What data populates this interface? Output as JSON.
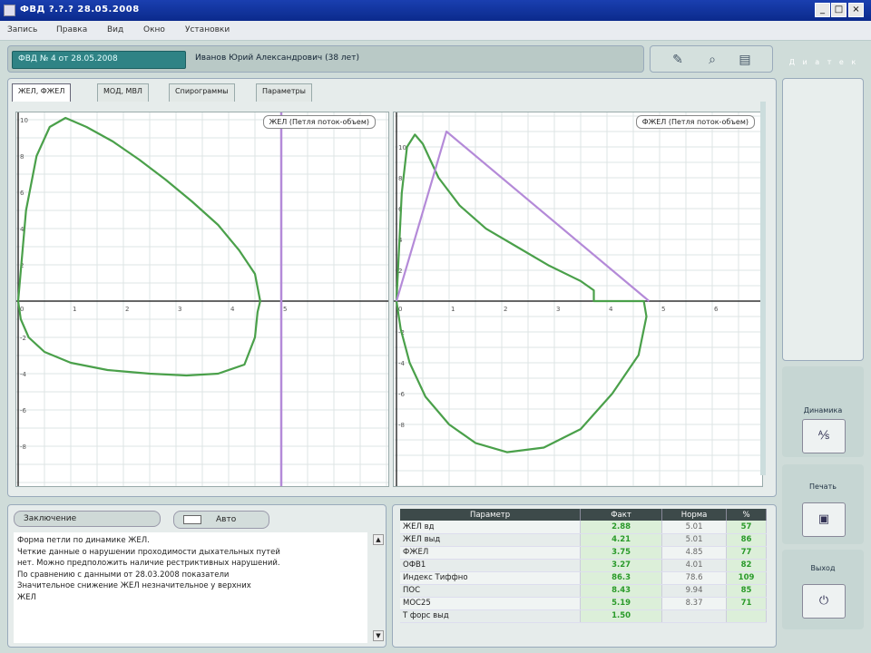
{
  "window": {
    "title": "ФВД  ?.?.?  28.05.2008"
  },
  "menu": [
    "Запись",
    "Правка",
    "Вид",
    "Окно",
    "Установки"
  ],
  "record_field": "ФВД  № 4  от  28.05.2008",
  "patient_name": "Иванов Юрий Александрович  (38 лет)",
  "toolbar": {
    "tool1_icon": "settings-icon",
    "tool2_icon": "search-icon",
    "tool3_icon": "printer-icon"
  },
  "brand_text": "Д и а т е к",
  "tabs": [
    "ЖЕЛ, ФЖЕЛ",
    "МОД, МВЛ",
    "Спирограммы",
    "Параметры"
  ],
  "chart_left": {
    "legend": "ЖЕЛ (Петля поток-объем)",
    "x_ticks": [
      "0",
      "1",
      "2",
      "3",
      "4",
      "5"
    ],
    "y_ticks": [
      "10",
      "8",
      "6",
      "4",
      "2",
      "0",
      "-2",
      "-4",
      "-6",
      "-8"
    ]
  },
  "chart_right": {
    "legend": "ФЖЕЛ (Петля поток-объем)",
    "x_ticks": [
      "0",
      "1",
      "2",
      "3",
      "4",
      "5",
      "6"
    ],
    "y_ticks": [
      "10",
      "8",
      "6",
      "4",
      "2",
      "0",
      "-2",
      "-4",
      "-6",
      "-8"
    ]
  },
  "conclusion": {
    "tab_label": "Заключение",
    "toggle_label": "Авто",
    "lines": [
      "Форма петли по динамике ЖЕЛ.",
      "Четкие данные о нарушении проходимости дыхательных путей",
      "нет. Можно предположить наличие рестриктивных нарушений.",
      "По сравнению с данными от 28.03.2008 показатели",
      "Значительное снижение ЖЕЛ незначительное у верхних",
      "ЖЕЛ"
    ]
  },
  "side": {
    "dynamics_label": "Динамика",
    "print_label": "Печать",
    "exit_label": "Выход",
    "dynamics_icon": "chart-dynamics-icon",
    "print_icon": "printer-icon",
    "exit_icon": "power-icon"
  },
  "table": {
    "headers": [
      "Параметр",
      "Факт",
      "Норма",
      "%"
    ],
    "rows": [
      {
        "param": "ЖЕЛ вд",
        "fact": "2.88",
        "norm": "5.01",
        "pct": "57"
      },
      {
        "param": "ЖЕЛ выд",
        "fact": "4.21",
        "norm": "5.01",
        "pct": "86"
      },
      {
        "param": "ФЖЕЛ",
        "fact": "3.75",
        "norm": "4.85",
        "pct": "77"
      },
      {
        "param": "ОФВ1",
        "fact": "3.27",
        "norm": "4.01",
        "pct": "82"
      },
      {
        "param": "Индекс Тиффно",
        "fact": "86.3",
        "norm": "78.6",
        "pct": "109"
      },
      {
        "param": "ПОС",
        "fact": "8.43",
        "norm": "9.94",
        "pct": "85"
      },
      {
        "param": "МОС25",
        "fact": "5.19",
        "norm": "8.37",
        "pct": "71"
      },
      {
        "param": "Т форс выд",
        "fact": "1.50",
        "norm": "",
        "pct": ""
      }
    ]
  },
  "colors": {
    "flow_curve": "#4aa04a",
    "reference": "#b48ad8",
    "accent": "#2f8385"
  },
  "chart_data": [
    {
      "type": "line",
      "title": "ЖЕЛ (Петля поток-объем)",
      "xlim": [
        0,
        7
      ],
      "ylim": [
        -10,
        10
      ],
      "series": [
        {
          "x": [
            0.0,
            0.15,
            0.35,
            0.6,
            0.9,
            1.3,
            1.8,
            2.3,
            2.8,
            3.3,
            3.8,
            4.2,
            4.5,
            4.6,
            4.55,
            4.5,
            4.3,
            3.8,
            3.2,
            2.5,
            1.7,
            1.0,
            0.5,
            0.2,
            0.05,
            0.0
          ],
          "y": [
            0,
            5,
            8,
            9.6,
            10.1,
            9.6,
            8.8,
            7.8,
            6.7,
            5.5,
            4.2,
            2.8,
            1.5,
            0,
            -0.6,
            -2.0,
            -3.5,
            -4.0,
            -4.1,
            -4.0,
            -3.8,
            -3.4,
            -2.8,
            -2.0,
            -1.0,
            0
          ]
        }
      ]
    },
    {
      "type": "line",
      "title": "ФЖЕЛ (Петля поток-объем)",
      "xlim": [
        0,
        7
      ],
      "ylim": [
        -12,
        12
      ],
      "series": [
        {
          "x": [
            0.0,
            0.1,
            0.2,
            0.35,
            0.5,
            0.8,
            1.2,
            1.7,
            2.3,
            2.9,
            3.5,
            3.75,
            3.75,
            4.7,
            4.75,
            4.6,
            4.1,
            3.5,
            2.8,
            2.1,
            1.5,
            1.0,
            0.55,
            0.25,
            0.08,
            0.0
          ],
          "y": [
            0,
            7,
            10,
            10.8,
            10.2,
            8.0,
            6.2,
            4.7,
            3.5,
            2.3,
            1.3,
            0.7,
            0,
            0,
            -1,
            -3.5,
            -6.0,
            -8.3,
            -9.5,
            -9.8,
            -9.2,
            -8.0,
            -6.2,
            -4.0,
            -1.8,
            0
          ]
        },
        {
          "x": [
            0,
            0.95,
            4.8
          ],
          "y": [
            0,
            11,
            0
          ]
        }
      ]
    }
  ]
}
